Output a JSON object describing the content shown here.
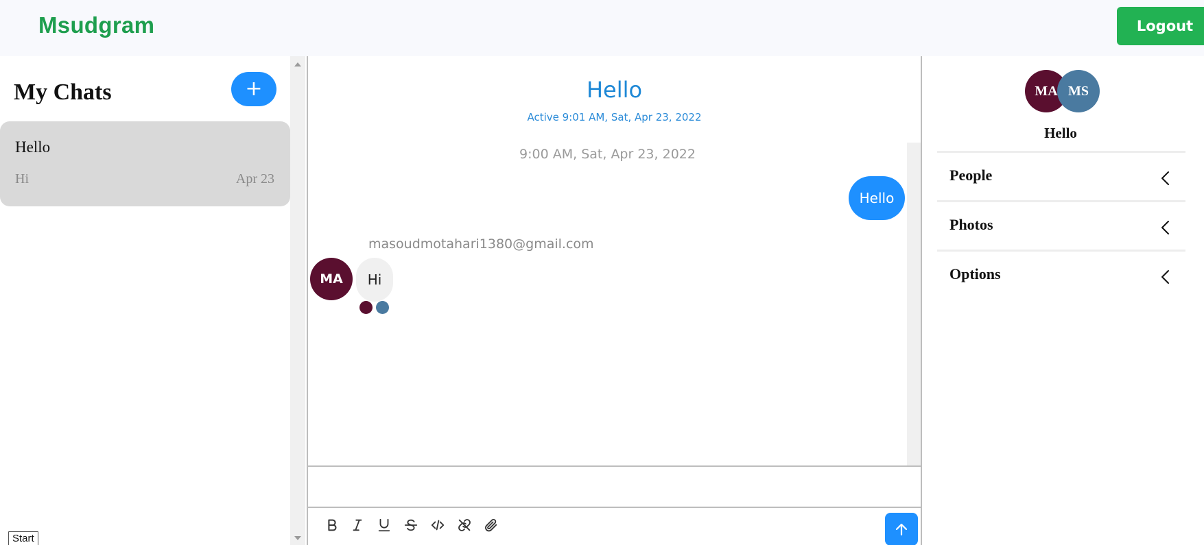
{
  "header": {
    "brand": "Msudgram",
    "logout_label": "Logout"
  },
  "sidebar": {
    "title": "My Chats",
    "new_chat_label": "+",
    "chats": [
      {
        "title": "Hello",
        "last_message": "Hi",
        "date": "Apr 23"
      }
    ],
    "start_label": "Start"
  },
  "chat": {
    "title": "Hello",
    "active_status": "Active 9:01 AM, Sat, Apr 23, 2022",
    "timestamp": "9:00 AM, Sat, Apr 23, 2022",
    "messages": [
      {
        "direction": "out",
        "text": "Hello"
      },
      {
        "direction": "in",
        "sender_email": "masoudmotahari1380@gmail.com",
        "avatar_initials": "MA",
        "text": "Hi"
      }
    ],
    "read_receipts_colors": [
      "#5a0f2f",
      "#4a7aa0"
    ],
    "composer_value": "",
    "toolbar_icons": [
      "bold-icon",
      "italic-icon",
      "underline-icon",
      "strikethrough-icon",
      "code-icon",
      "link-icon",
      "attachment-icon"
    ],
    "send_icon": "arrow-up-icon"
  },
  "details": {
    "avatars": [
      {
        "initials": "MA",
        "color": "#5a0f2f"
      },
      {
        "initials": "MS",
        "color": "#4a7aa0"
      }
    ],
    "title": "Hello",
    "sections": [
      {
        "label": "People"
      },
      {
        "label": "Photos"
      },
      {
        "label": "Options"
      }
    ]
  },
  "colors": {
    "brand": "#1e9e4e",
    "logout": "#22b253",
    "accent": "#1e90ff",
    "header_bg": "#f8f9fd",
    "selected_chat_bg": "#d9d9d9"
  }
}
